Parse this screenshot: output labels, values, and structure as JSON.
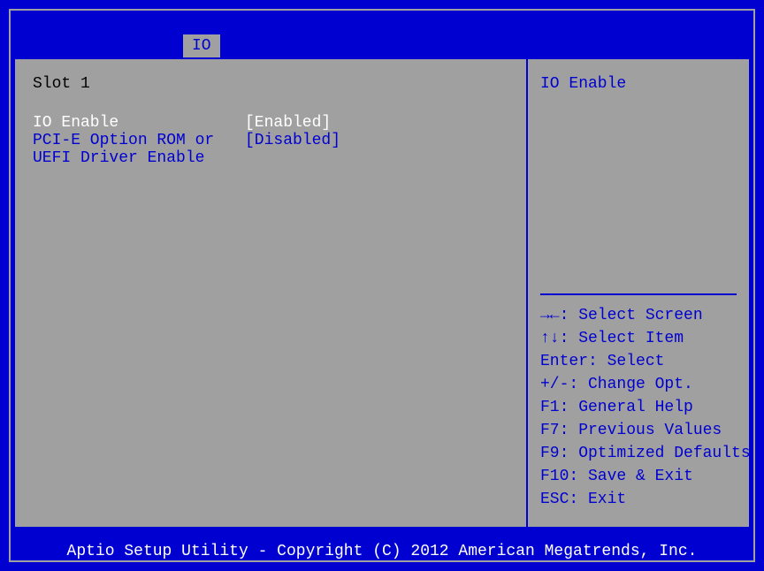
{
  "tab": {
    "label": "IO"
  },
  "main": {
    "section_title": "Slot 1",
    "rows": [
      {
        "label": "IO Enable",
        "value": "[Enabled]",
        "selected": true
      },
      {
        "label": "PCI-E Option ROM or UEFI Driver Enable",
        "value": "[Disabled]",
        "selected": false
      }
    ]
  },
  "side": {
    "help_title": "IO Enable",
    "help_items": [
      "→←: Select Screen",
      "↑↓: Select Item",
      "Enter: Select",
      "+/-: Change Opt.",
      "F1: General Help",
      "F7: Previous Values",
      "F9: Optimized Defaults",
      "F10: Save & Exit",
      "ESC: Exit"
    ]
  },
  "footer": "Aptio Setup Utility - Copyright (C) 2012 American Megatrends, Inc."
}
